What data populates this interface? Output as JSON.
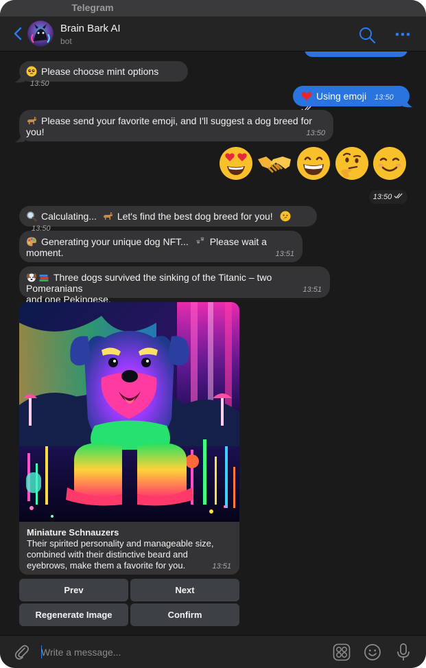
{
  "window": {
    "app_title": "Telegram"
  },
  "header": {
    "name": "Brain Bark AI",
    "status": "bot",
    "icons": [
      "back-chevron-icon",
      "search-icon",
      "more-dots-icon"
    ],
    "accent": "#2e7bf0"
  },
  "messages": [
    {
      "dir": "in",
      "emoji": "pleading-face",
      "text": "Please choose mint options",
      "time": "13:50"
    },
    {
      "dir": "out",
      "emoji": "red-heart",
      "text": "Using emoji",
      "time": "13:50",
      "status": "read"
    },
    {
      "dir": "in",
      "emoji": "dog",
      "text": "Please send your favorite emoji, and I'll suggest a dog breed for you!",
      "time": "13:50"
    },
    {
      "dir": "out",
      "type": "emoji",
      "emojis": [
        "heart-eyes",
        "handshake",
        "grinning-face",
        "thinking-face",
        "smiling-face"
      ],
      "time": "13:50",
      "status": "read"
    },
    {
      "dir": "in",
      "text_a": "Calculating...",
      "text_b": "Let's find the best dog breed for you!",
      "time": "13:50"
    },
    {
      "dir": "in",
      "text_a": "Generating your unique dog NFT...",
      "text_b": "Please wait a moment.",
      "time": "13:51"
    },
    {
      "dir": "in",
      "line1": "Three dogs survived the sinking of the Titanic – two Pomeranians",
      "line2": "and one Pekingese.",
      "time": "13:51"
    },
    {
      "dir": "in",
      "type": "photo",
      "image_alt": "Neon-colored Miniature Schnauzer lying in a glowing mushroom field",
      "title": "Miniature Schnauzers",
      "caption_lines": [
        "Their spirited personality and manageable size,",
        "combined with their distinctive beard and",
        "eyebrows, make them a favorite for you."
      ],
      "time": "13:51"
    }
  ],
  "keyboard": {
    "prev": "Prev",
    "next": "Next",
    "regenerate": "Regenerate Image",
    "confirm": "Confirm"
  },
  "composer": {
    "placeholder": "Write a message...",
    "icons": [
      "attach-icon",
      "stickers-icon",
      "emoji-icon",
      "microphone-icon"
    ]
  }
}
